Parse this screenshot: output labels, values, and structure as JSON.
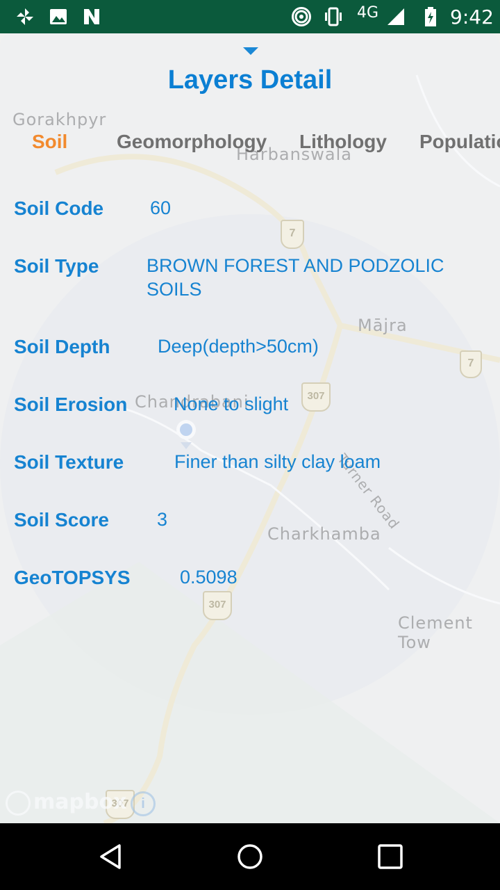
{
  "status_bar": {
    "network": "4G",
    "time": "9:42",
    "icons": [
      "pinwheel-icon",
      "image-icon",
      "n-app-icon",
      "hotspot-icon",
      "vibrate-icon",
      "signal-icon",
      "battery-icon"
    ]
  },
  "map": {
    "labels": [
      "Gorakhpyr",
      "Harbanswala",
      "Mājra",
      "Chandrabani",
      "Turner Road",
      "Charkhamba",
      "Clement Tow"
    ],
    "road_badges": [
      "7",
      "7",
      "307",
      "307",
      "307"
    ],
    "attribution": "mapbox"
  },
  "sheet": {
    "title": "Layers Detail",
    "tabs": [
      {
        "label": "Soil",
        "active": true
      },
      {
        "label": "Geomorphology",
        "active": false
      },
      {
        "label": "Lithology",
        "active": false
      },
      {
        "label": "Populatio",
        "active": false
      }
    ],
    "rows": [
      {
        "label": "Soil Code",
        "value": "60"
      },
      {
        "label": "Soil Type",
        "value": "BROWN FOREST AND PODZOLIC",
        "value2": "SOILS"
      },
      {
        "label": "Soil Depth",
        "value": "Deep(depth>50cm)"
      },
      {
        "label": "Soil Erosion",
        "value": "None to slight"
      },
      {
        "label": "Soil Texture",
        "value": "Finer than silty clay loam"
      },
      {
        "label": "Soil Score",
        "value": "3"
      },
      {
        "label": "GeoTOPSYS",
        "value": "0.5098"
      }
    ]
  },
  "colors": {
    "status_bar": "#0b5a3c",
    "title": "#0b7fd3",
    "field": "#1683d1",
    "active_tab": "#f28a2e",
    "inactive_tab": "#707070"
  }
}
